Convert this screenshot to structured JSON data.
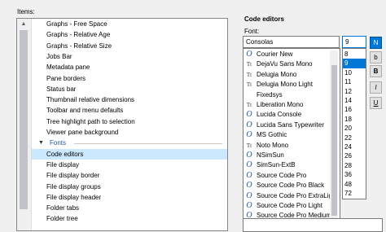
{
  "items_label": "Items:",
  "tree_items_a": [
    "Graphs - Free Space",
    "Graphs - Relative Age",
    "Graphs - Relative Size",
    "Jobs Bar",
    "Metadata pane",
    "Pane borders",
    "Status bar",
    "Thumbnail relative dimensions",
    "Toolbar and menu defaults",
    "Tree highlight path to selection",
    "Viewer pane background"
  ],
  "group_fonts": "Fonts",
  "tree_items_b": [
    "Code editors",
    "File display",
    "File display border",
    "File display groups",
    "File display header",
    "Folder tabs",
    "Folder tree"
  ],
  "selected_item": "Code editors",
  "right": {
    "title": "Code editors",
    "font_label": "Font:",
    "font_value": "Consolas",
    "size_value": "9"
  },
  "fonts": [
    {
      "icon": "O",
      "name": "Courier New"
    },
    {
      "icon": "Tt",
      "name": "DejaVu Sans Mono"
    },
    {
      "icon": "Tt",
      "name": "Delugia Mono"
    },
    {
      "icon": "Tt",
      "name": "Delugia Mono Light"
    },
    {
      "icon": "",
      "name": "Fixedsys"
    },
    {
      "icon": "Tt",
      "name": "Liberation Mono"
    },
    {
      "icon": "O",
      "name": "Lucida Console"
    },
    {
      "icon": "O",
      "name": "Lucida Sans Typewriter"
    },
    {
      "icon": "O",
      "name": "MS Gothic"
    },
    {
      "icon": "Tt",
      "name": "Noto Mono"
    },
    {
      "icon": "O",
      "name": "NSimSun"
    },
    {
      "icon": "O",
      "name": "SimSun-ExtB"
    },
    {
      "icon": "O",
      "name": "Source Code Pro"
    },
    {
      "icon": "O",
      "name": "Source Code Pro Black"
    },
    {
      "icon": "O",
      "name": "Source Code Pro ExtraLight"
    },
    {
      "icon": "O",
      "name": "Source Code Pro Light"
    },
    {
      "icon": "O",
      "name": "Source Code Pro Medium"
    }
  ],
  "sizes": [
    "8",
    "9",
    "10",
    "11",
    "12",
    "14",
    "16",
    "18",
    "20",
    "22",
    "24",
    "26",
    "28",
    "36",
    "48",
    "72"
  ],
  "selected_size": "9",
  "style_buttons": [
    {
      "label": "N",
      "active": true
    },
    {
      "label": "b",
      "active": false
    },
    {
      "label": "B",
      "active": false
    },
    {
      "label": "I",
      "active": false
    },
    {
      "label": "U",
      "active": false
    }
  ],
  "colors": {
    "accent": "#0078d7",
    "selection": "#cce8ff",
    "group_text": "#1e56b3"
  }
}
